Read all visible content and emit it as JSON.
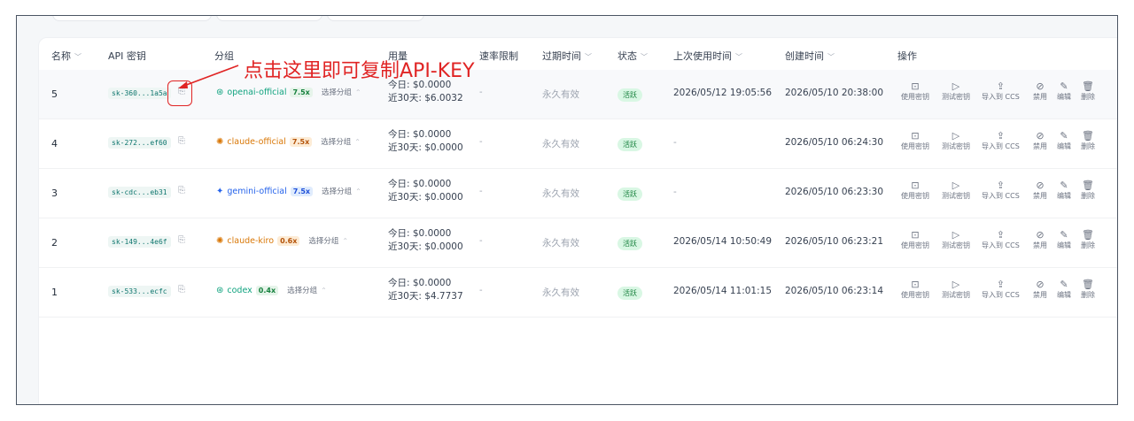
{
  "headers": {
    "name": "名称",
    "key": "API 密钥",
    "group": "分组",
    "usage": "用量",
    "rate": "速率限制",
    "expire": "过期时间",
    "status": "状态",
    "last_used": "上次使用时间",
    "created": "创建时间",
    "actions": "操作"
  },
  "actions": [
    "使用密钥",
    "测试密钥",
    "导入到 CCS",
    "禁用",
    "编辑",
    "删除"
  ],
  "rows": [
    {
      "name": "5",
      "key": "sk-360...1a5a",
      "group": "openai-official",
      "group_mult": "7.5x",
      "group_icon": "openai-icon",
      "select": "选择分组",
      "usage_today": "今日: $0.0000",
      "usage_30d": "近30天: $6.0032",
      "rate": "-",
      "expire": "永久有效",
      "status": "活跃",
      "last_used": "2026/05/12 19:05:56",
      "created": "2026/05/10 20:38:00"
    },
    {
      "name": "4",
      "key": "sk-272...ef60",
      "group": "claude-official",
      "group_mult": "7.5x",
      "group_icon": "claude-icon",
      "select": "选择分组",
      "usage_today": "今日: $0.0000",
      "usage_30d": "近30天: $0.0000",
      "rate": "-",
      "expire": "永久有效",
      "status": "活跃",
      "last_used": "-",
      "created": "2026/05/10 06:24:30"
    },
    {
      "name": "3",
      "key": "sk-cdc...eb31",
      "group": "gemini-official",
      "group_mult": "7.5x",
      "group_icon": "gemini-icon",
      "select": "选择分组",
      "usage_today": "今日: $0.0000",
      "usage_30d": "近30天: $0.0000",
      "rate": "-",
      "expire": "永久有效",
      "status": "活跃",
      "last_used": "-",
      "created": "2026/05/10 06:23:30"
    },
    {
      "name": "2",
      "key": "sk-149...4e6f",
      "group": "claude-kiro",
      "group_mult": "0.6x",
      "group_icon": "claude-icon",
      "select": "选择分组",
      "usage_today": "今日: $0.0000",
      "usage_30d": "近30天: $0.0000",
      "rate": "-",
      "expire": "永久有效",
      "status": "活跃",
      "last_used": "2026/05/14 10:50:49",
      "created": "2026/05/10 06:23:21"
    },
    {
      "name": "1",
      "key": "sk-533...ecfc",
      "group": "codex",
      "group_mult": "0.4x",
      "group_icon": "openai-icon",
      "select": "选择分组",
      "usage_today": "今日: $0.0000",
      "usage_30d": "近30天: $4.7737",
      "rate": "-",
      "expire": "永久有效",
      "status": "活跃",
      "last_used": "2026/05/14 11:01:15",
      "created": "2026/05/10 06:23:14"
    }
  ],
  "annotation": "点击这里即可复制API-KEY",
  "colors": {
    "annotation": "#e02424",
    "status_bg": "#d9f7e4",
    "status_text": "#16803c",
    "openai": "#10a37f",
    "claude": "#d97706",
    "gemini": "#2563eb"
  }
}
